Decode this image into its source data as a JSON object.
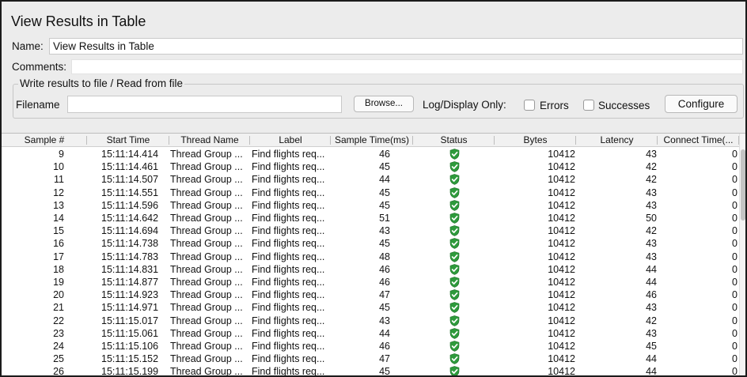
{
  "window": {
    "title": "View Results in Table"
  },
  "form": {
    "name_label": "Name:",
    "name_value": "View Results in Table",
    "comments_label": "Comments:",
    "comments_value": ""
  },
  "file_group": {
    "title": "Write results to file / Read from file",
    "filename_label": "Filename",
    "filename_value": "",
    "browse_label": "Browse...",
    "log_display_label": "Log/Display Only:",
    "errors_label": "Errors",
    "errors_checked": false,
    "successes_label": "Successes",
    "successes_checked": false,
    "configure_label": "Configure"
  },
  "table": {
    "columns": [
      "Sample #",
      "Start Time",
      "Thread Name",
      "Label",
      "Sample Time(ms)",
      "Status",
      "Bytes",
      "Latency",
      "Connect Time(..."
    ],
    "rows": [
      {
        "sample": "9",
        "start": "15:11:14.414",
        "thread": "Thread Group ...",
        "label": "Find flights req...",
        "time": "46",
        "status": "success",
        "bytes": "10412",
        "latency": "43",
        "connect": "0"
      },
      {
        "sample": "10",
        "start": "15:11:14.461",
        "thread": "Thread Group ...",
        "label": "Find flights req...",
        "time": "45",
        "status": "success",
        "bytes": "10412",
        "latency": "42",
        "connect": "0"
      },
      {
        "sample": "11",
        "start": "15:11:14.507",
        "thread": "Thread Group ...",
        "label": "Find flights req...",
        "time": "44",
        "status": "success",
        "bytes": "10412",
        "latency": "42",
        "connect": "0"
      },
      {
        "sample": "12",
        "start": "15:11:14.551",
        "thread": "Thread Group ...",
        "label": "Find flights req...",
        "time": "45",
        "status": "success",
        "bytes": "10412",
        "latency": "43",
        "connect": "0"
      },
      {
        "sample": "13",
        "start": "15:11:14.596",
        "thread": "Thread Group ...",
        "label": "Find flights req...",
        "time": "45",
        "status": "success",
        "bytes": "10412",
        "latency": "43",
        "connect": "0"
      },
      {
        "sample": "14",
        "start": "15:11:14.642",
        "thread": "Thread Group ...",
        "label": "Find flights req...",
        "time": "51",
        "status": "success",
        "bytes": "10412",
        "latency": "50",
        "connect": "0"
      },
      {
        "sample": "15",
        "start": "15:11:14.694",
        "thread": "Thread Group ...",
        "label": "Find flights req...",
        "time": "43",
        "status": "success",
        "bytes": "10412",
        "latency": "42",
        "connect": "0"
      },
      {
        "sample": "16",
        "start": "15:11:14.738",
        "thread": "Thread Group ...",
        "label": "Find flights req...",
        "time": "45",
        "status": "success",
        "bytes": "10412",
        "latency": "43",
        "connect": "0"
      },
      {
        "sample": "17",
        "start": "15:11:14.783",
        "thread": "Thread Group ...",
        "label": "Find flights req...",
        "time": "48",
        "status": "success",
        "bytes": "10412",
        "latency": "43",
        "connect": "0"
      },
      {
        "sample": "18",
        "start": "15:11:14.831",
        "thread": "Thread Group ...",
        "label": "Find flights req...",
        "time": "46",
        "status": "success",
        "bytes": "10412",
        "latency": "44",
        "connect": "0"
      },
      {
        "sample": "19",
        "start": "15:11:14.877",
        "thread": "Thread Group ...",
        "label": "Find flights req...",
        "time": "46",
        "status": "success",
        "bytes": "10412",
        "latency": "44",
        "connect": "0"
      },
      {
        "sample": "20",
        "start": "15:11:14.923",
        "thread": "Thread Group ...",
        "label": "Find flights req...",
        "time": "47",
        "status": "success",
        "bytes": "10412",
        "latency": "46",
        "connect": "0"
      },
      {
        "sample": "21",
        "start": "15:11:14.971",
        "thread": "Thread Group ...",
        "label": "Find flights req...",
        "time": "45",
        "status": "success",
        "bytes": "10412",
        "latency": "43",
        "connect": "0"
      },
      {
        "sample": "22",
        "start": "15:11:15.017",
        "thread": "Thread Group ...",
        "label": "Find flights req...",
        "time": "43",
        "status": "success",
        "bytes": "10412",
        "latency": "42",
        "connect": "0"
      },
      {
        "sample": "23",
        "start": "15:11:15.061",
        "thread": "Thread Group ...",
        "label": "Find flights req...",
        "time": "44",
        "status": "success",
        "bytes": "10412",
        "latency": "43",
        "connect": "0"
      },
      {
        "sample": "24",
        "start": "15:11:15.106",
        "thread": "Thread Group ...",
        "label": "Find flights req...",
        "time": "46",
        "status": "success",
        "bytes": "10412",
        "latency": "45",
        "connect": "0"
      },
      {
        "sample": "25",
        "start": "15:11:15.152",
        "thread": "Thread Group ...",
        "label": "Find flights req...",
        "time": "47",
        "status": "success",
        "bytes": "10412",
        "latency": "44",
        "connect": "0"
      },
      {
        "sample": "26",
        "start": "15:11:15.199",
        "thread": "Thread Group ...",
        "label": "Find flights req...",
        "time": "45",
        "status": "success",
        "bytes": "10412",
        "latency": "44",
        "connect": "0"
      }
    ]
  },
  "icons": {
    "status_success": "shield-check-icon"
  },
  "colors": {
    "success_green": "#2e9a3c",
    "window_bg": "#ececec"
  }
}
